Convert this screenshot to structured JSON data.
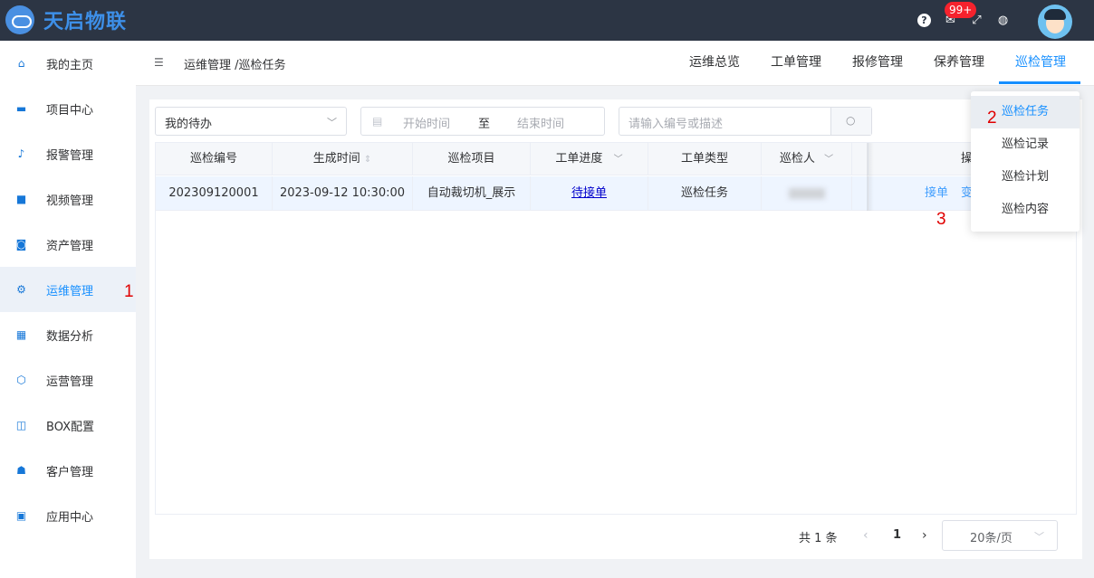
{
  "app": {
    "logo_text": "天启物联"
  },
  "topbar": {
    "help_icon": "question-circle-icon",
    "mail_icon": "mail-icon",
    "badge": "99+",
    "fullscreen_icon": "fullscreen-icon",
    "language_icon": "globe-icon",
    "avatar_icon": "avatar-icon"
  },
  "sidebar": {
    "items": [
      {
        "label": "我的主页",
        "icon": "home-icon",
        "glyph": "⌂"
      },
      {
        "label": "项目中心",
        "icon": "project-icon",
        "glyph": "▬"
      },
      {
        "label": "报警管理",
        "icon": "bell-icon",
        "glyph": "♪"
      },
      {
        "label": "视频管理",
        "icon": "video-icon",
        "glyph": "■"
      },
      {
        "label": "资产管理",
        "icon": "asset-icon",
        "glyph": "◙"
      },
      {
        "label": "运维管理",
        "icon": "gear-icon",
        "glyph": "⚙"
      },
      {
        "label": "数据分析",
        "icon": "chart-icon",
        "glyph": "▦"
      },
      {
        "label": "运营管理",
        "icon": "shield-icon",
        "glyph": "⬡"
      },
      {
        "label": "BOX配置",
        "icon": "box-icon",
        "glyph": "◫"
      },
      {
        "label": "客户管理",
        "icon": "users-icon",
        "glyph": "☗"
      },
      {
        "label": "应用中心",
        "icon": "apps-icon",
        "glyph": "▣"
      }
    ],
    "active_index": 5
  },
  "header": {
    "breadcrumb": "运维管理 /巡检任务",
    "tabs": [
      {
        "label": "运维总览"
      },
      {
        "label": "工单管理"
      },
      {
        "label": "报修管理"
      },
      {
        "label": "保养管理"
      },
      {
        "label": "巡检管理"
      }
    ],
    "active_tab": 4
  },
  "filters": {
    "status_select": "我的待办",
    "date_start_placeholder": "开始时间",
    "date_separator": "至",
    "date_end_placeholder": "结束时间",
    "search_placeholder": "请输入编号或描述"
  },
  "table": {
    "headers": [
      "巡检编号",
      "生成时间",
      "巡检项目",
      "工单进度",
      "工单类型",
      "巡检人",
      "操"
    ],
    "rows": [
      {
        "id": "202309120001",
        "created": "2023-09-12 10:30:00",
        "project": "自动裁切机_展示",
        "progress": "待接单",
        "type": "巡检任务",
        "inspector": "",
        "actions": [
          "接单",
          "变"
        ]
      }
    ]
  },
  "pagination": {
    "total": "共 1 条",
    "page": "1",
    "page_size": "20条/页"
  },
  "dropdown": {
    "items": [
      "巡检任务",
      "巡检记录",
      "巡检计划",
      "巡检内容"
    ],
    "active_index": 0
  },
  "annotations": {
    "a1": "1",
    "a2": "2",
    "a3": "3"
  },
  "colors": {
    "accent": "#1890ff",
    "topbar": "#2c3544",
    "link": "#0000cc",
    "annotation": "#e00000"
  }
}
